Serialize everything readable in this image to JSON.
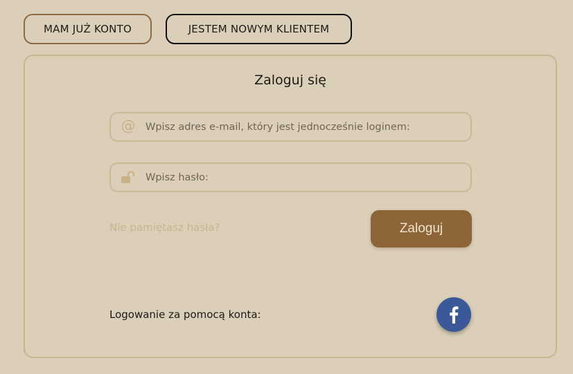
{
  "tabs": {
    "existing_account": "MAM JUŻ KONTO",
    "new_customer": "JESTEM NOWYM KLIENTEM"
  },
  "login": {
    "title": "Zaloguj się",
    "email_placeholder": "Wpisz adres e-mail, który jest jednocześnie loginem:",
    "email_value": "",
    "password_placeholder": "Wpisz hasło:",
    "password_value": "",
    "forgot_password": "Nie pamiętasz hasła?",
    "submit_label": "Zaloguj",
    "social_label": "Logowanie za pomocą konta:",
    "social_provider_icon": "facebook-icon"
  },
  "colors": {
    "background": "#dbcfb9",
    "accent_brown": "#8d6539",
    "field_border": "#c9b995",
    "link": "#c6b58d",
    "facebook_blue": "#3b5998"
  }
}
